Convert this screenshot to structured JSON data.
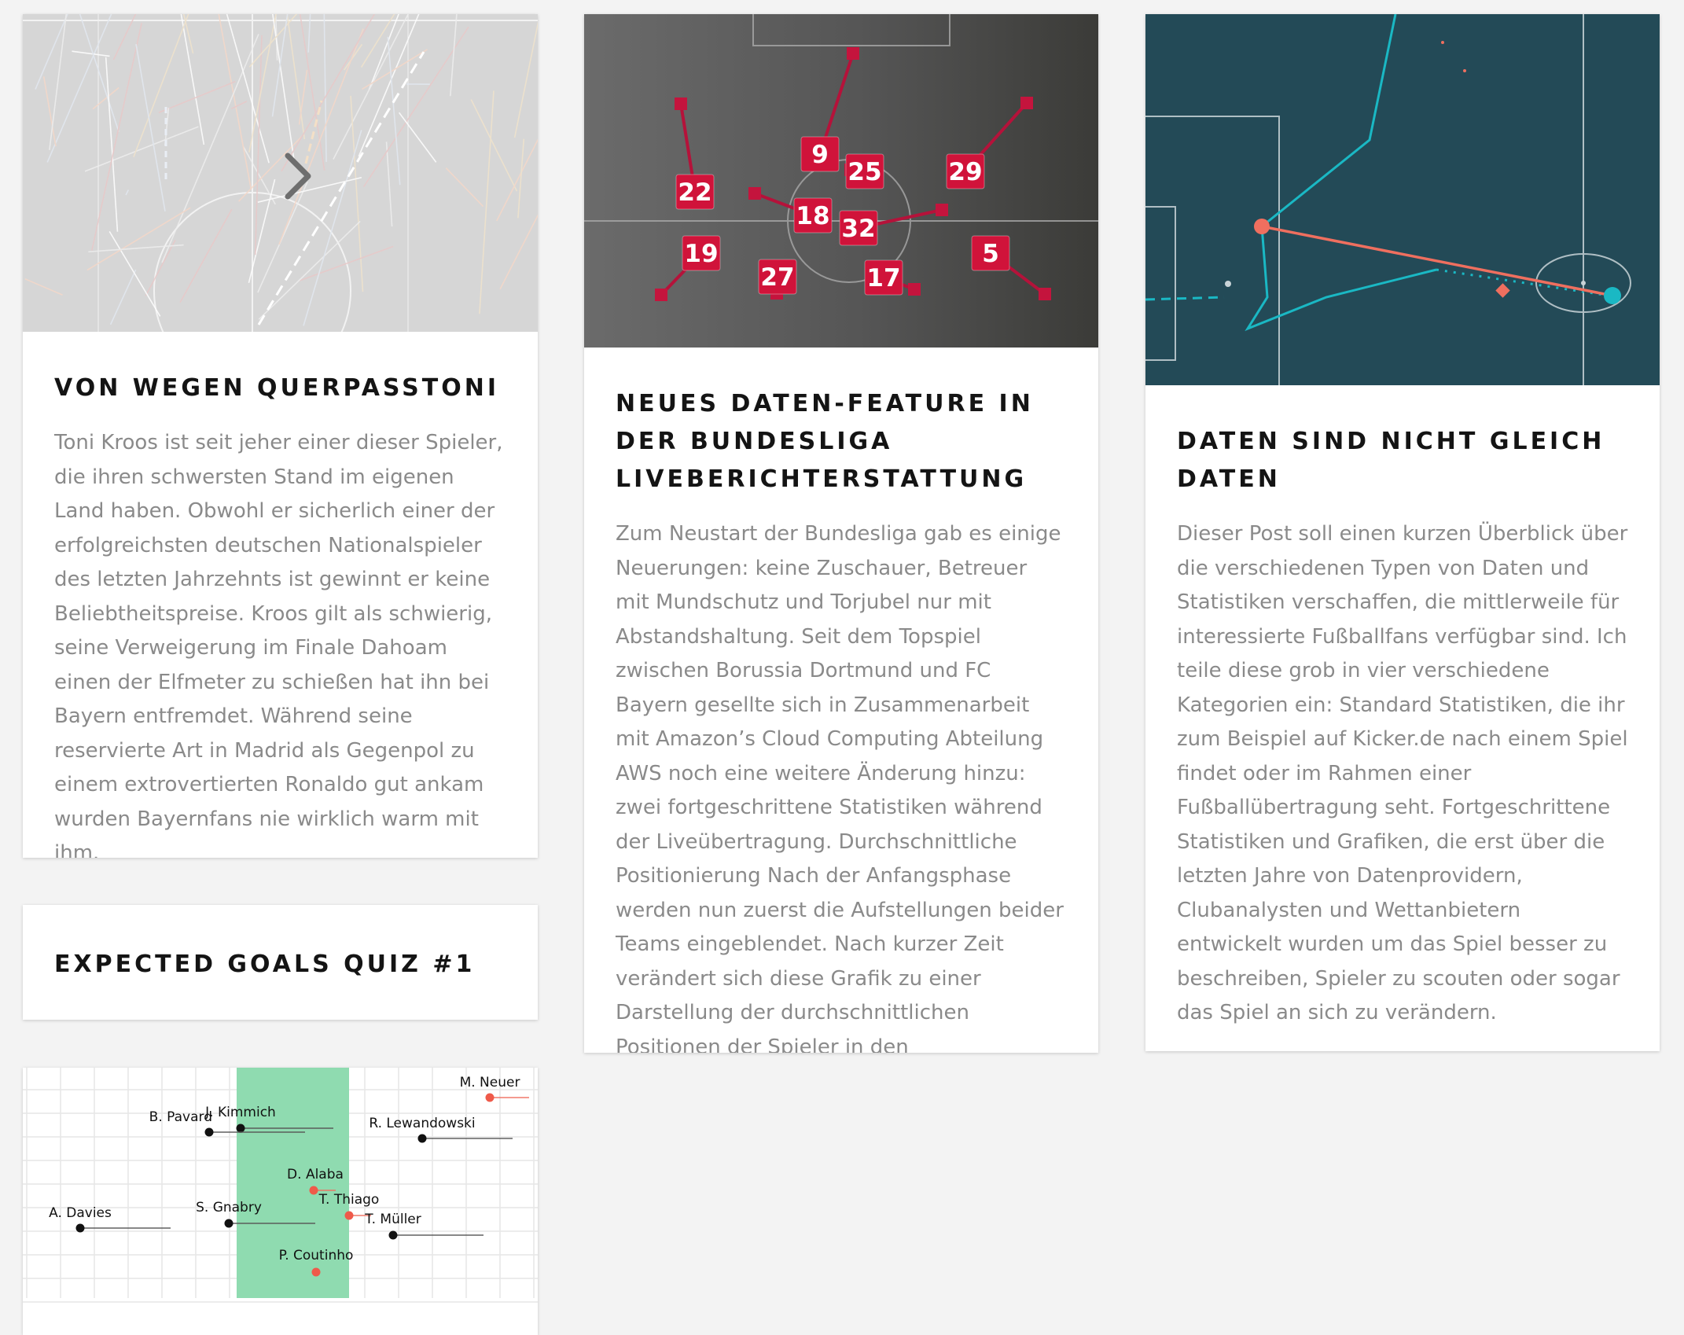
{
  "posts": [
    {
      "title": "VON WEGEN QUERPASSTONI",
      "excerpt": "Toni Kroos ist seit jeher einer dieser Spieler, die ihren schwersten Stand im eigenen Land haben. Obwohl er sicherlich einer der erfolgreichsten deutschen Nationalspieler des letzten Jahrzehnts ist gewinnt er keine Beliebtheitspreise. Kroos gilt als schwierig, seine Verweigerung im Finale Dahoam einen der Elfmeter zu schießen hat ihn bei Bayern entfremdet. Während seine reservierte Art in Madrid als Gegenpol zu einem extrovertierten Ronaldo gut ankam wurden Bayernfans nie wirklich warm mit ihm.",
      "image_icon": "chevron-right-icon"
    },
    {
      "title": "NEUES DATEN-FEATURE IN DER BUNDESLIGA LIVEBERICHTERSTATTUNG",
      "excerpt": "Zum Neustart der Bundesliga gab es einige Neuerungen: keine Zuschauer, Betreuer mit Mundschutz und Torjubel nur mit Abstandshaltung. Seit dem Topspiel zwischen Borussia Dortmund und FC Bayern gesellte sich in Zusammenarbeit mit Amazon’s Cloud Computing Abteilung AWS noch eine weitere Änderung hinzu: zwei fortgeschrittene Statistiken während der Liveübertragung. Durchschnittliche Positionierung Nach der Anfangsphase werden nun zuerst die Aufstellungen beider Teams eingeblendet. Nach kurzer Zeit verändert sich diese Grafik zu einer Darstellung der durchschnittlichen Positionen der Spieler in den Anfangsminuten.",
      "player_numbers": [
        "22",
        "19",
        "27",
        "9",
        "18",
        "25",
        "32",
        "17",
        "29",
        "5"
      ]
    },
    {
      "title": "DATEN SIND NICHT GLEICH DATEN",
      "excerpt": "Dieser Post soll einen kurzen Überblick über die verschiedenen Typen von Daten und Statistiken verschaffen, die mittlerweile für interessierte Fußballfans verfügbar sind. Ich teile diese grob in vier verschiedene Kategorien ein: Standard Statistiken, die ihr zum Beispiel auf Kicker.de nach einem Spiel findet oder im Rahmen einer Fußballübertragung seht. Fortgeschrittene Statistiken und Grafiken, die erst über die letzten Jahre von Datenprovidern, Clubanalysten und Wettanbietern entwickelt wurden um das Spiel besser zu beschreiben, Spieler zu scouten oder sogar das Spiel an sich zu verändern."
    },
    {
      "title": "EXPECTED GOALS QUIZ #1"
    },
    {
      "players": [
        "M. Neuer",
        "J. Kimmich",
        "B. Pavard",
        "R. Lewandowski",
        "D. Alaba",
        "T. Thiago",
        "A. Davies",
        "S. Gnabry",
        "T. Müller",
        "P. Coutinho"
      ]
    }
  ],
  "colors": {
    "background": "#f3f3f3",
    "title": "#141414",
    "excerpt": "#8a8a8a",
    "badge_red": "#d0133a",
    "pitch_teal": "#234a57",
    "accent_cyan": "#1ab8c4",
    "accent_salmon": "#ef6f5f",
    "band_green": "#8fdbb0"
  }
}
